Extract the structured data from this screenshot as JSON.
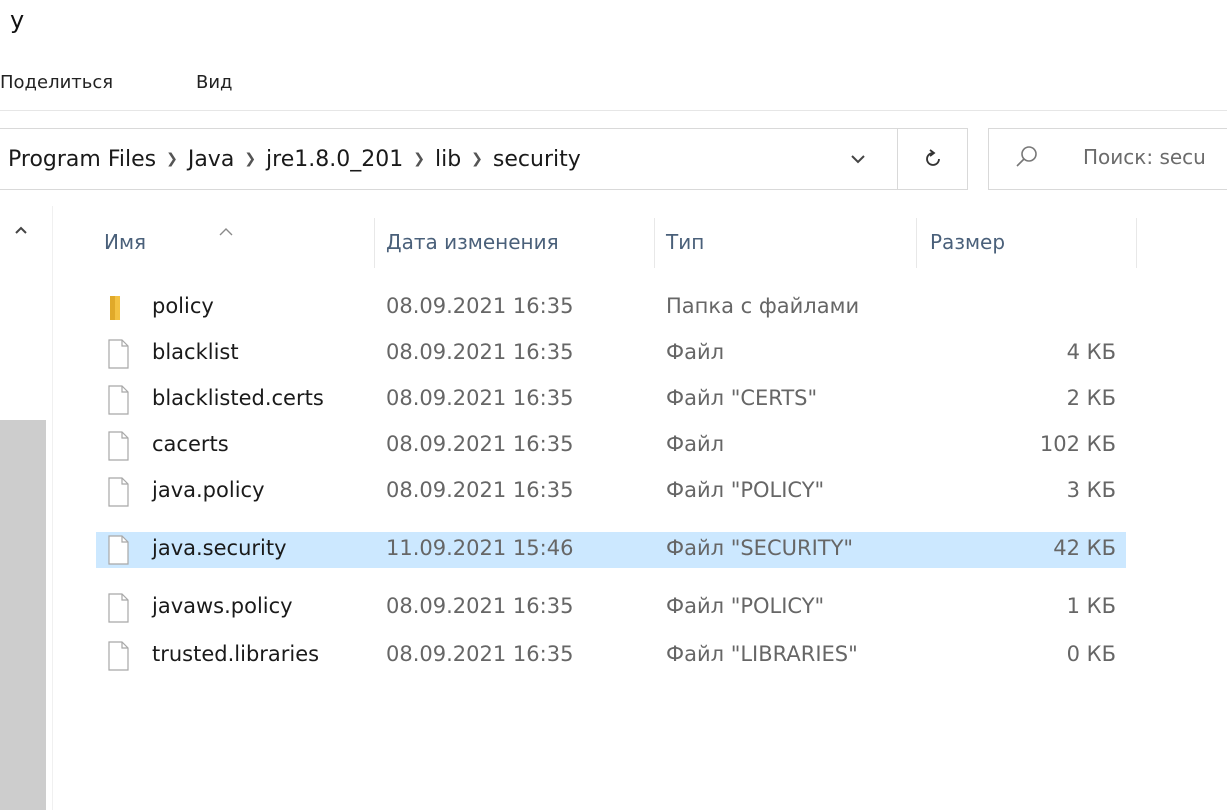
{
  "window": {
    "title_fragment": "у"
  },
  "ribbon": {
    "tabs": [
      "Поделиться",
      "Вид"
    ]
  },
  "address_bar": {
    "crumbs": [
      "Program Files",
      "Java",
      "jre1.8.0_201",
      "lib",
      "security"
    ]
  },
  "search": {
    "placeholder": "Поиск: secu"
  },
  "columns": {
    "name": "Имя",
    "date": "Дата изменения",
    "type": "Тип",
    "size": "Размер"
  },
  "files": [
    {
      "name": "policy",
      "date": "08.09.2021 16:35",
      "type": "Папка с файлами",
      "size": "",
      "icon": "folder-icon",
      "selected": false
    },
    {
      "name": "blacklist",
      "date": "08.09.2021 16:35",
      "type": "Файл",
      "size": "4 КБ",
      "icon": "file-icon",
      "selected": false
    },
    {
      "name": "blacklisted.certs",
      "date": "08.09.2021 16:35",
      "type": "Файл \"CERTS\"",
      "size": "2 КБ",
      "icon": "file-icon",
      "selected": false
    },
    {
      "name": "cacerts",
      "date": "08.09.2021 16:35",
      "type": "Файл",
      "size": "102 КБ",
      "icon": "file-icon",
      "selected": false
    },
    {
      "name": "java.policy",
      "date": "08.09.2021 16:35",
      "type": "Файл \"POLICY\"",
      "size": "3 КБ",
      "icon": "file-icon",
      "selected": false
    },
    {
      "name": "java.security",
      "date": "11.09.2021 15:46",
      "type": "Файл \"SECURITY\"",
      "size": "42 КБ",
      "icon": "file-icon",
      "selected": true
    },
    {
      "name": "javaws.policy",
      "date": "08.09.2021 16:35",
      "type": "Файл \"POLICY\"",
      "size": "1 КБ",
      "icon": "file-icon",
      "selected": false
    },
    {
      "name": "trusted.libraries",
      "date": "08.09.2021 16:35",
      "type": "Файл \"LIBRARIES\"",
      "size": "0 КБ",
      "icon": "file-icon",
      "selected": false
    }
  ],
  "colors": {
    "selection": "#cce8ff",
    "folder": "#f3c142",
    "header_text": "#4a607a"
  }
}
